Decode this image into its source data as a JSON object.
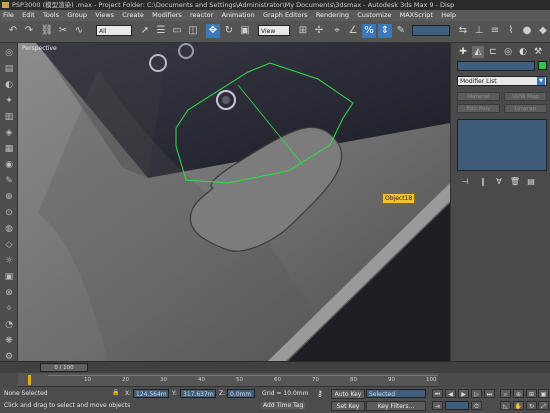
{
  "title": "PSP3000 (模型渲染) .max    - Project Folder: C:\\Documents and Settings\\Administrator\\My Documents\\3dsmax    - Autodesk 3ds Max 9    - Disp",
  "menu": [
    "File",
    "Edit",
    "Tools",
    "Group",
    "Views",
    "Create",
    "Modifiers",
    "reactor",
    "Animation",
    "Graph Editors",
    "Rendering",
    "Customize",
    "MAXScript",
    "Help"
  ],
  "toolbar": {
    "selection_filter": "All",
    "ref_coord": "View",
    "named_selection": ""
  },
  "viewport": {
    "label": "Perspective",
    "object_tag": "Object18"
  },
  "command_panel": {
    "object_name": "",
    "modifier_list": "Modifier List",
    "buttons": [
      "Material",
      "UVW Map",
      "Edit Poly",
      "Unwrap"
    ]
  },
  "timeline": {
    "slider_label": "0 / 100",
    "ticks": [
      "10",
      "20",
      "30",
      "40",
      "50",
      "60",
      "70",
      "80",
      "90",
      "100"
    ]
  },
  "status": {
    "selection": "None Selected",
    "prompt": "Click and drag to select and move objects",
    "x_label": "X:",
    "x_value": "124.564m",
    "y_label": "Y:",
    "y_value": "317.637m",
    "z_label": "Z:",
    "z_value": "0.0mm",
    "grid": "Grid = 10.0mm",
    "auto_key": "Auto Key",
    "key_mode": "Selected",
    "set_key": "Set Key",
    "key_filters": "Key Filters...",
    "add_time_tag": "Add Time Tag"
  },
  "colors": {
    "accent": "#3a78b8",
    "object_color": "#26c94b",
    "tag": "#f2c230"
  }
}
